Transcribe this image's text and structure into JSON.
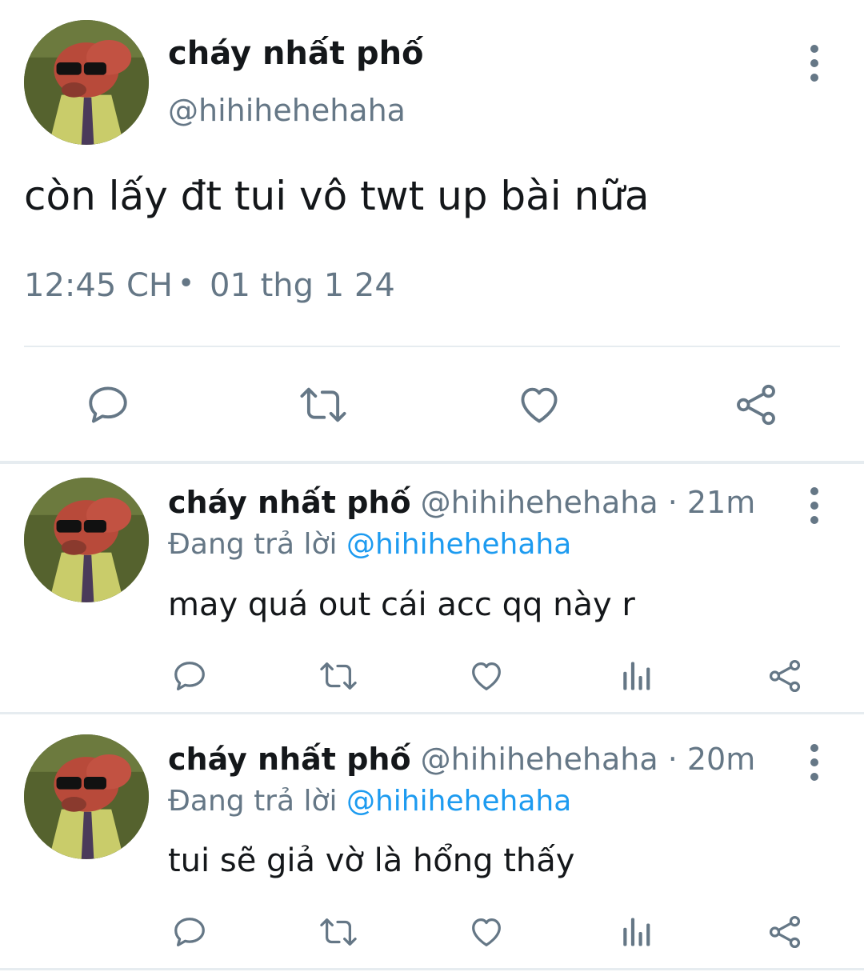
{
  "main_tweet": {
    "display_name": "cháy nhất phố",
    "handle": "@hihihehehaha",
    "text": "còn lấy đt tui vô twt up bài nữa",
    "time": "12:45 CH",
    "separator": "•",
    "date": "01 thg 1 24",
    "actions": [
      "reply-icon",
      "retweet-icon",
      "like-icon",
      "share-icon"
    ]
  },
  "replies": [
    {
      "display_name": "cháy nhất phố",
      "handle": "@hihihehehaha",
      "age": "· 21m",
      "replying_prefix": "Đang trả lời",
      "replying_to": "@hihihehehaha",
      "text": "may quá out cái acc qq này r",
      "actions": [
        "reply-icon",
        "retweet-icon",
        "like-icon",
        "analytics-icon",
        "share-icon"
      ]
    },
    {
      "display_name": "cháy nhất phố",
      "handle": "@hihihehehaha",
      "age": "· 20m",
      "replying_prefix": "Đang trả lời",
      "replying_to": "@hihihehehaha",
      "text": "tui sẽ giả vờ là hổng thấy",
      "actions": [
        "reply-icon",
        "retweet-icon",
        "like-icon",
        "analytics-icon",
        "share-icon"
      ]
    }
  ],
  "colors": {
    "text": "#14171a",
    "secondary": "#657786",
    "link": "#1d9bf0",
    "divider": "#e6ecf0"
  }
}
